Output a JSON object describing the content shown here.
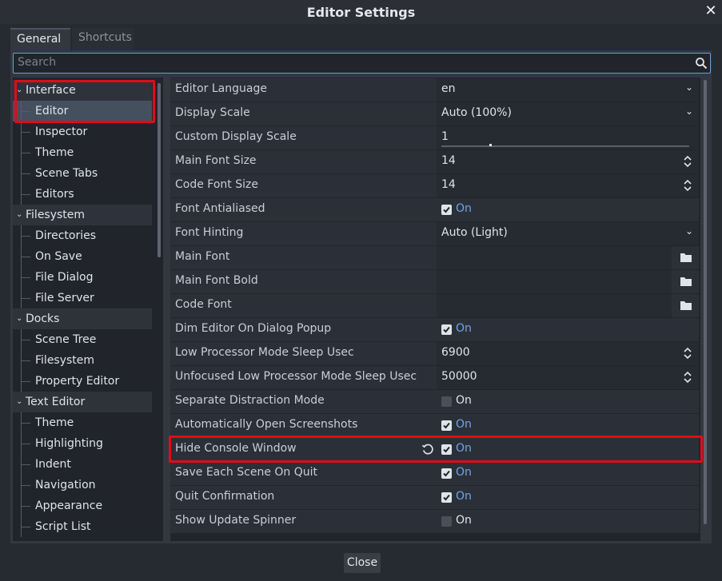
{
  "window": {
    "title": "Editor Settings",
    "close_glyph": "✕"
  },
  "tabs": [
    {
      "label": "General",
      "active": true
    },
    {
      "label": "Shortcuts",
      "active": false
    }
  ],
  "search": {
    "placeholder": "Search",
    "icon": "search-icon"
  },
  "tree": [
    {
      "label": "Interface",
      "section": true,
      "expanded": true
    },
    {
      "label": "Editor",
      "selected": true
    },
    {
      "label": "Inspector"
    },
    {
      "label": "Theme"
    },
    {
      "label": "Scene Tabs"
    },
    {
      "label": "Editors"
    },
    {
      "label": "Filesystem",
      "section": true,
      "expanded": true
    },
    {
      "label": "Directories"
    },
    {
      "label": "On Save"
    },
    {
      "label": "File Dialog"
    },
    {
      "label": "File Server"
    },
    {
      "label": "Docks",
      "section": true,
      "expanded": true
    },
    {
      "label": "Scene Tree"
    },
    {
      "label": "Filesystem"
    },
    {
      "label": "Property Editor"
    },
    {
      "label": "Text Editor",
      "section": true,
      "expanded": true
    },
    {
      "label": "Theme"
    },
    {
      "label": "Highlighting"
    },
    {
      "label": "Indent"
    },
    {
      "label": "Navigation"
    },
    {
      "label": "Appearance"
    },
    {
      "label": "Script List"
    }
  ],
  "properties": [
    {
      "label": "Editor Language",
      "kind": "dropdown",
      "value": "en"
    },
    {
      "label": "Display Scale",
      "kind": "dropdown",
      "value": "Auto (100%)"
    },
    {
      "label": "Custom Display Scale",
      "kind": "slider",
      "value": "1"
    },
    {
      "label": "Main Font Size",
      "kind": "spin",
      "value": "14"
    },
    {
      "label": "Code Font Size",
      "kind": "spin",
      "value": "14"
    },
    {
      "label": "Font Antialiased",
      "kind": "check",
      "checked": true,
      "text": "On"
    },
    {
      "label": "Font Hinting",
      "kind": "dropdown",
      "value": "Auto (Light)"
    },
    {
      "label": "Main Font",
      "kind": "path",
      "value": ""
    },
    {
      "label": "Main Font Bold",
      "kind": "path",
      "value": ""
    },
    {
      "label": "Code Font",
      "kind": "path",
      "value": ""
    },
    {
      "label": "Dim Editor On Dialog Popup",
      "kind": "check",
      "checked": true,
      "text": "On"
    },
    {
      "label": "Low Processor Mode Sleep Usec",
      "kind": "spin",
      "value": "6900"
    },
    {
      "label": "Unfocused Low Processor Mode Sleep Usec",
      "kind": "spin",
      "value": "50000"
    },
    {
      "label": "Separate Distraction Mode",
      "kind": "check",
      "checked": false,
      "text": "On"
    },
    {
      "label": "Automatically Open Screenshots",
      "kind": "check",
      "checked": true,
      "text": "On"
    },
    {
      "label": "Hide Console Window",
      "kind": "check",
      "checked": true,
      "text": "On",
      "revert": true
    },
    {
      "label": "Save Each Scene On Quit",
      "kind": "check",
      "checked": true,
      "text": "On"
    },
    {
      "label": "Quit Confirmation",
      "kind": "check",
      "checked": true,
      "text": "On"
    },
    {
      "label": "Show Update Spinner",
      "kind": "check",
      "checked": false,
      "text": "On"
    }
  ],
  "footer": {
    "close_label": "Close"
  },
  "colors": {
    "accent": "#6ea5ea",
    "highlight": "#e00d16"
  }
}
